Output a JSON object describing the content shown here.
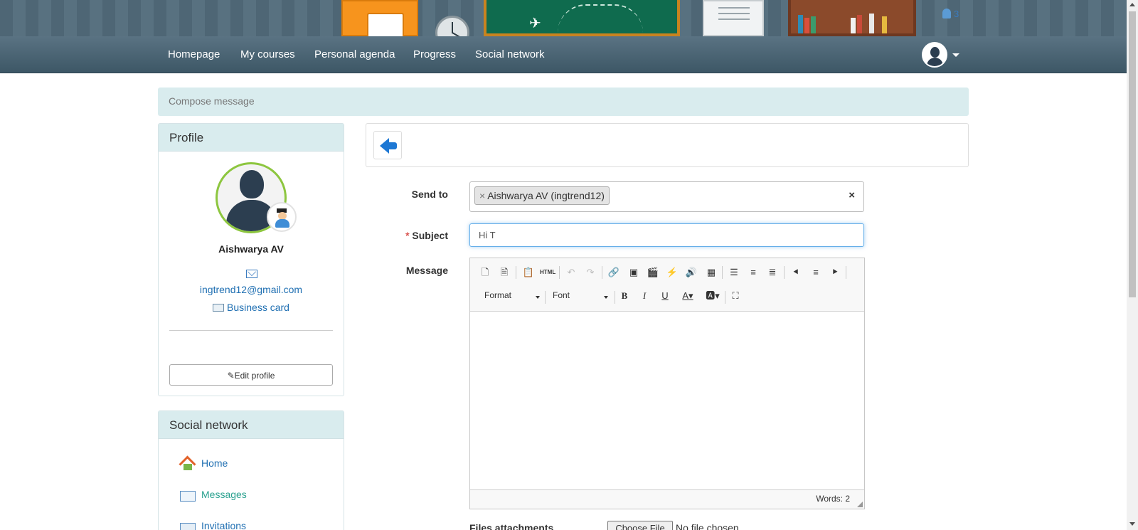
{
  "header": {
    "online_count": "3"
  },
  "nav": {
    "items": [
      "Homepage",
      "My courses",
      "Personal agenda",
      "Progress",
      "Social network"
    ]
  },
  "breadcrumb": "Compose message",
  "profile": {
    "heading": "Profile",
    "name": "Aishwarya AV",
    "email": "ingtrend12@gmail.com",
    "business_card": "Business card",
    "edit_button": "Edit profile"
  },
  "social": {
    "heading": "Social network",
    "items": [
      "Home",
      "Messages",
      "Invitations"
    ]
  },
  "form": {
    "send_to_label": "Send to",
    "recipient": "Aishwarya AV (ingtrend12)",
    "tag_remove": "×",
    "clear": "×",
    "subject_required": "*",
    "subject_label": "Subject",
    "subject_value": "Hi T",
    "message_label": "Message",
    "format_combo": "Format",
    "font_combo": "Font",
    "words": "Words: 2",
    "files_label": "Files attachments",
    "choose_file": "Choose File",
    "no_file": "No file chosen"
  },
  "colors": {
    "accent": "#1f6fb2",
    "active": "#2aa18f",
    "panel_heading": "#d9ecee",
    "nav": "#4a6473"
  },
  "icons": [
    "back-arrow-icon",
    "mail-icon",
    "business-card-icon",
    "edit-icon",
    "home-icon",
    "messages-icon",
    "invitations-icon",
    "user-icon",
    "teacher-icon"
  ]
}
